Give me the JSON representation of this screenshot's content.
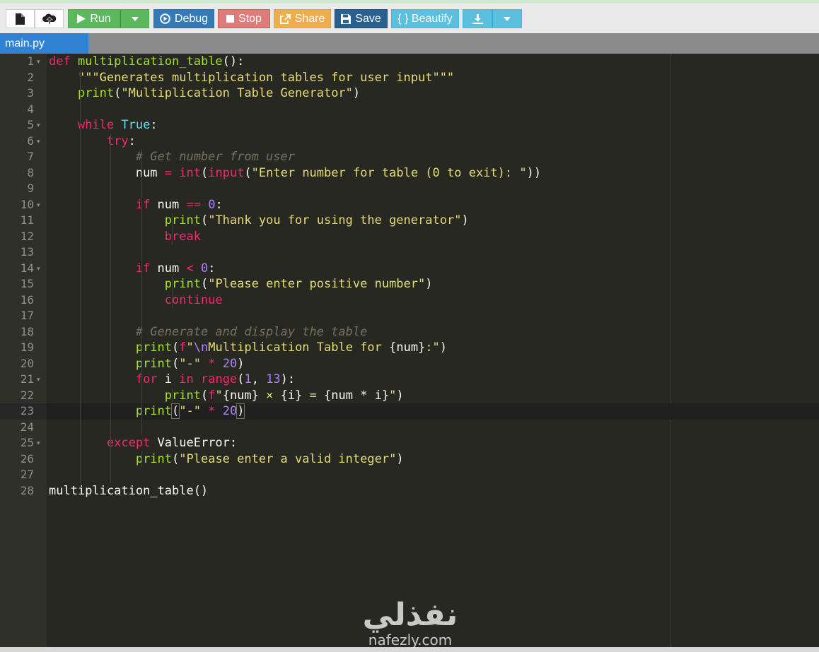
{
  "toolbar": {
    "run_label": "Run",
    "debug_label": "Debug",
    "stop_label": "Stop",
    "share_label": "Share",
    "save_label": "Save",
    "beautify_label": "{ } Beautify"
  },
  "file_tab": "main.py",
  "colors": {
    "run": "#5cb85c",
    "debug": "#337ab7",
    "stop": "#d9534f",
    "share": "#f0ad4e",
    "save": "#286090",
    "beautify": "#5bc0de",
    "tab": "#2f82d4",
    "editor_bg": "#272822"
  },
  "code_lines": [
    "def multiplication_table():",
    "    \"\"\"Generates multiplication tables for user input\"\"\"",
    "    print(\"Multiplication Table Generator\")",
    "",
    "    while True:",
    "        try:",
    "            # Get number from user",
    "            num = int(input(\"Enter number for table (0 to exit): \"))",
    "",
    "            if num == 0:",
    "                print(\"Thank you for using the generator\")",
    "                break",
    "",
    "            if num < 0:",
    "                print(\"Please enter positive number\")",
    "                continue",
    "",
    "            # Generate and display the table",
    "            print(f\"\\nMultiplication Table for {num}:\")",
    "            print(\"-\" * 20)",
    "            for i in range(1, 13):",
    "                print(f\"{num} × {i} = {num * i}\")",
    "            print(\"-\" * 20)",
    "",
    "        except ValueError:",
    "            print(\"Please enter a valid integer\")",
    "",
    "multiplication_table()"
  ],
  "watermark": {
    "arabic": "نفذلي",
    "latin": "nafezly.com"
  }
}
